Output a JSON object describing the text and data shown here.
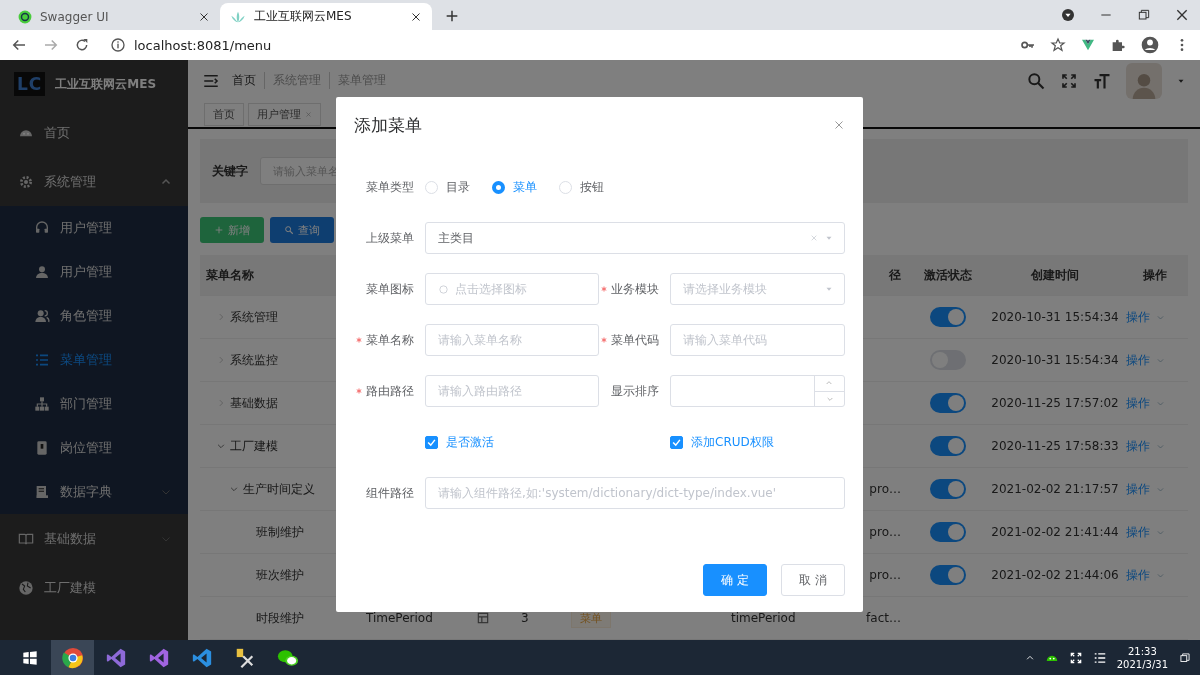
{
  "browser": {
    "tabs": [
      {
        "title": "Swagger UI",
        "selected": false
      },
      {
        "title": "工业互联网云MES",
        "selected": true
      }
    ],
    "url": "localhost:8081/menu"
  },
  "sidebar": {
    "logo": "LC",
    "title": "工业互联网云MES",
    "items": [
      {
        "label": "首页",
        "selected": false
      },
      {
        "label": "系统管理",
        "selected": false,
        "expanded": true,
        "children": [
          {
            "label": "用户管理",
            "selected": false
          },
          {
            "label": "用户管理",
            "selected": false
          },
          {
            "label": "角色管理",
            "selected": false
          },
          {
            "label": "菜单管理",
            "selected": true
          },
          {
            "label": "部门管理",
            "selected": false
          },
          {
            "label": "岗位管理",
            "selected": false
          },
          {
            "label": "数据字典",
            "selected": false,
            "expanded": false
          }
        ]
      },
      {
        "label": "基础数据",
        "selected": false,
        "expanded": false
      },
      {
        "label": "工厂建模",
        "selected": false
      }
    ]
  },
  "header": {
    "breadcrumb": [
      "首页",
      "系统管理",
      "菜单管理"
    ],
    "tags": [
      {
        "label": "首页",
        "closable": false
      },
      {
        "label": "用户管理",
        "closable": true
      }
    ]
  },
  "filter": {
    "label": "关键字",
    "placeholder": "请输入菜单名"
  },
  "toolbar": [
    {
      "label": "新增",
      "kind": "add"
    },
    {
      "label": "查询",
      "kind": "search"
    }
  ],
  "table": {
    "headings": {
      "name": "菜单名称",
      "column_8": "径",
      "active": "激活状态",
      "created": "创建时间",
      "action": "操作"
    },
    "rows": [
      {
        "name": "系统管理",
        "expanded": false,
        "active": true,
        "created": "2020-10-31 15:54:34",
        "action": "操作"
      },
      {
        "name": "系统监控",
        "expanded": false,
        "active": false,
        "created": "2020-10-31 15:54:34",
        "action": "操作"
      },
      {
        "name": "基础数据",
        "expanded": false,
        "active": true,
        "created": "2020-11-25 17:57:02",
        "action": "操作"
      },
      {
        "name": "工厂建模",
        "expanded": true,
        "active": true,
        "created": "2020-11-25 17:58:33",
        "action": "操作",
        "children": [
          {
            "name": "生产时间定义",
            "expanded": true,
            "column_8": "pro…",
            "active": true,
            "created": "2021-02-02 21:17:57",
            "action": "操作",
            "children": [
              {
                "name": "班制维护",
                "column_8": "pro…",
                "active": true,
                "created": "2021-02-02 21:41:44",
                "action": "操作"
              },
              {
                "name": "班次维护",
                "column_8": "pro…",
                "active": true,
                "created": "2021-02-02 21:44:06",
                "action": "操作"
              },
              {
                "name": "时段维护",
                "column_2": "TimePeriod",
                "icon": true,
                "column_4": "3",
                "tag": "菜单",
                "column_7": "timePeriod",
                "column_8": "fact…"
              }
            ]
          }
        ]
      }
    ]
  },
  "dialog": {
    "title": "添加菜单",
    "rows": [
      {
        "fields": [
          {
            "kind": "radio",
            "label": "菜单类型",
            "required": false,
            "options": [
              {
                "label": "目录",
                "selected": false
              },
              {
                "label": "菜单",
                "selected": true
              },
              {
                "label": "按钮",
                "selected": false
              }
            ]
          }
        ]
      },
      {
        "fields": [
          {
            "kind": "select",
            "label": "上级菜单",
            "required": false,
            "value": "主类目",
            "clearable": true
          }
        ]
      },
      {
        "fields": [
          {
            "kind": "icon-picker",
            "label": "菜单图标",
            "required": false,
            "placeholder": "点击选择图标"
          },
          {
            "kind": "select",
            "label": "业务模块",
            "required": true,
            "placeholder": "请选择业务模块"
          }
        ]
      },
      {
        "fields": [
          {
            "kind": "input",
            "label": "菜单名称",
            "required": true,
            "placeholder": "请输入菜单名称"
          },
          {
            "kind": "input",
            "label": "菜单代码",
            "required": true,
            "placeholder": "请输入菜单代码"
          }
        ]
      },
      {
        "fields": [
          {
            "kind": "input",
            "label": "路由路径",
            "required": true,
            "placeholder": "请输入路由路径"
          },
          {
            "kind": "number",
            "label": "显示排序",
            "required": false
          }
        ]
      },
      {
        "fields": [
          {
            "kind": "checkbox",
            "label": "是否激活",
            "checked": true
          },
          {
            "kind": "checkbox",
            "label": "添加CRUD权限",
            "checked": true
          }
        ]
      },
      {
        "fields": [
          {
            "kind": "input",
            "label": "组件路径",
            "required": false,
            "placeholder": "请输入组件路径,如:'system/dictionary/dict-type/index.vue'"
          }
        ]
      }
    ],
    "buttons": [
      {
        "label": "确 定",
        "kind": "primary"
      },
      {
        "label": "取 消",
        "kind": "default"
      }
    ]
  },
  "taskbar": {
    "time": "21:33",
    "date": "2021/3/31"
  }
}
